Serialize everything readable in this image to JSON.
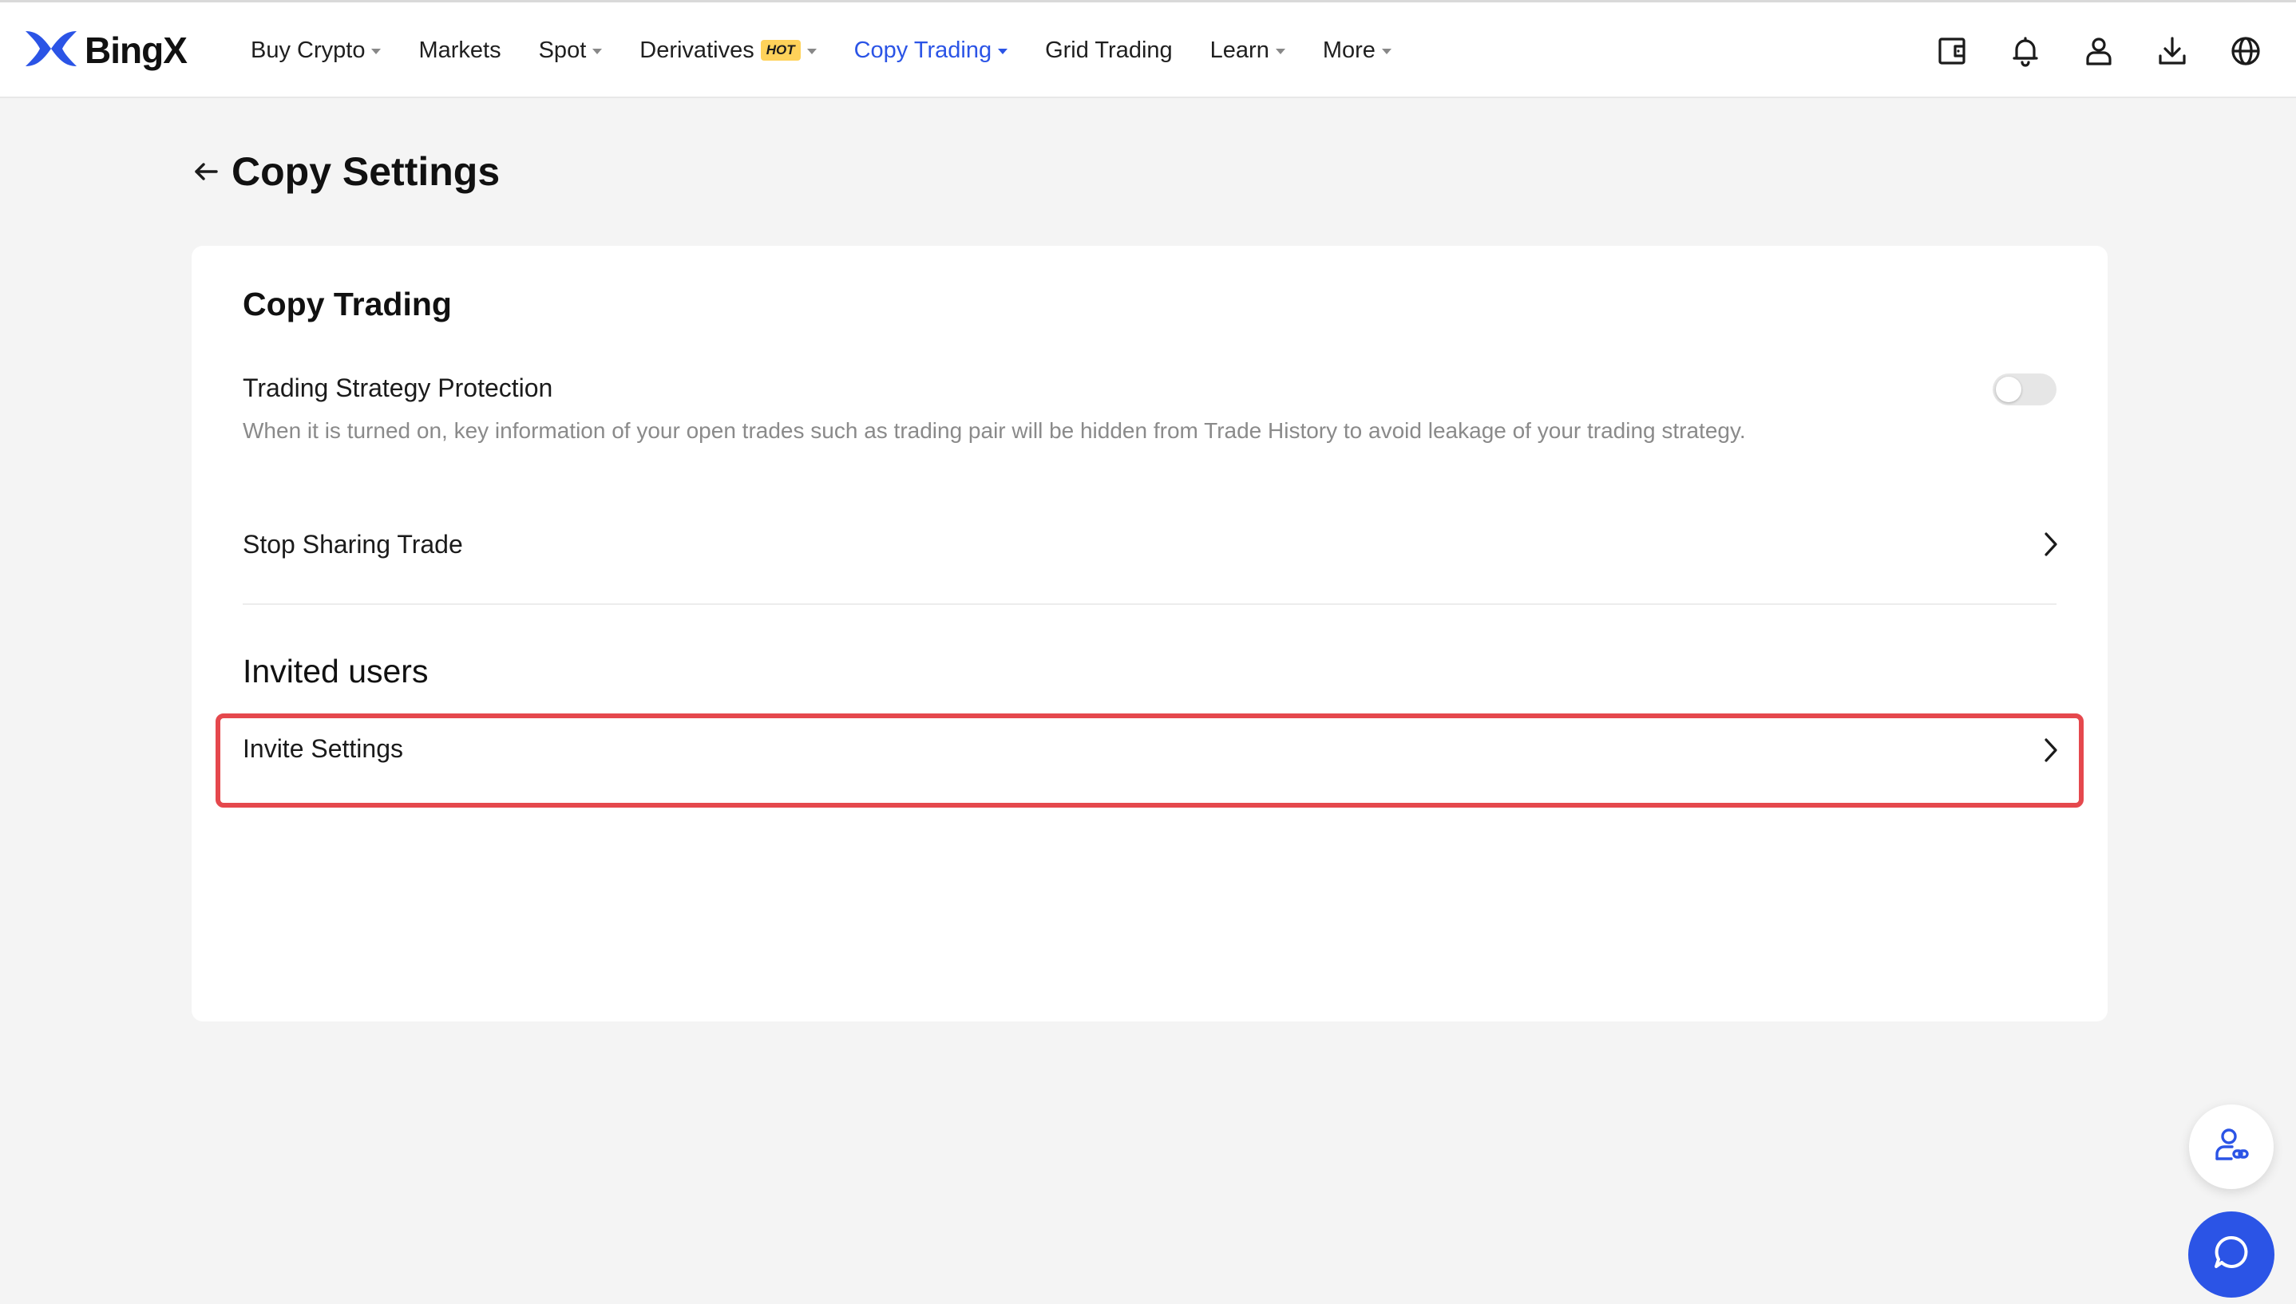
{
  "brand": {
    "name": "BingX",
    "logo_icon": "bingx-x-icon",
    "accent_color": "#2b54e6",
    "hot_color": "#ffd25a",
    "highlight_color": "#e5484d"
  },
  "nav": {
    "items": [
      {
        "label": "Buy Crypto",
        "dropdown": true,
        "active": false
      },
      {
        "label": "Markets",
        "dropdown": false,
        "active": false
      },
      {
        "label": "Spot",
        "dropdown": true,
        "active": false
      },
      {
        "label": "Derivatives",
        "badge": "HOT",
        "dropdown": true,
        "active": false
      },
      {
        "label": "Copy Trading",
        "dropdown": true,
        "active": true
      },
      {
        "label": "Grid Trading",
        "dropdown": false,
        "active": false
      },
      {
        "label": "Learn",
        "dropdown": true,
        "active": false
      },
      {
        "label": "More",
        "dropdown": true,
        "active": false
      }
    ],
    "icons": [
      "wallet-icon",
      "bell-icon",
      "user-icon",
      "download-icon",
      "globe-icon"
    ]
  },
  "page": {
    "title": "Copy Settings"
  },
  "card": {
    "copy_trading": {
      "title": "Copy Trading",
      "protection": {
        "label": "Trading Strategy Protection",
        "description": "When it is turned on, key information of your open trades such as trading pair will be hidden from Trade History to avoid leakage of your trading strategy.",
        "enabled": false
      },
      "stop_sharing": {
        "label": "Stop Sharing Trade"
      }
    },
    "invited_users": {
      "title": "Invited users",
      "invite_settings": {
        "label": "Invite Settings"
      }
    }
  },
  "floating": {
    "support_icon": "customer-service-icon",
    "chat_icon": "chat-bubble-icon"
  }
}
